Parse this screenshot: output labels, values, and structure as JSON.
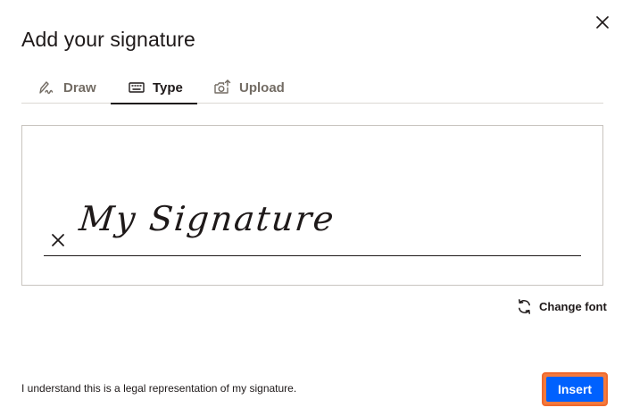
{
  "dialog": {
    "title": "Add your signature",
    "close_icon": "close-icon"
  },
  "tabs": [
    {
      "label": "Draw",
      "icon": "pen-draw-icon",
      "active": false
    },
    {
      "label": "Type",
      "icon": "keyboard-icon",
      "active": true
    },
    {
      "label": "Upload",
      "icon": "camera-upload-icon",
      "active": false
    }
  ],
  "signature": {
    "text": "My Signature",
    "clear_icon": "clear-x-icon"
  },
  "change_font": {
    "label": "Change font",
    "icon": "refresh-icon"
  },
  "footer": {
    "legal_text": "I understand this is a legal representation of my signature.",
    "insert_label": "Insert"
  },
  "colors": {
    "accent": "#0061fe",
    "focus_ring": "#f57a3d",
    "text": "#1e1919",
    "muted": "#736c64"
  }
}
